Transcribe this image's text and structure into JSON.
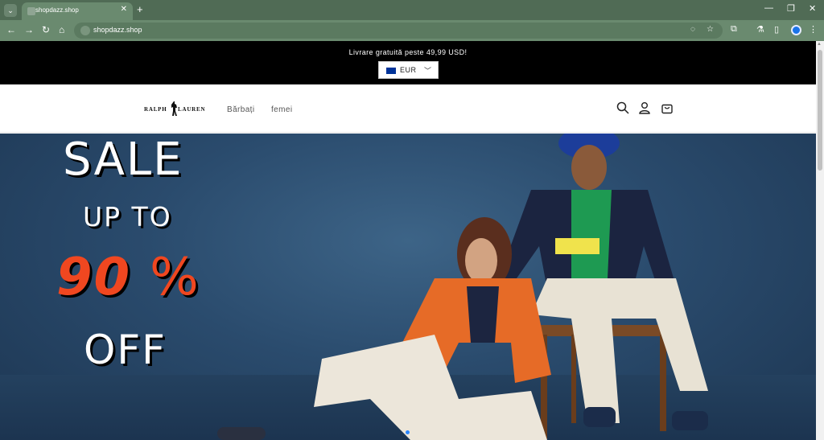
{
  "browser": {
    "tab": {
      "title": "shopdazz.shop"
    },
    "url": "shopdazz.shop",
    "icons": [
      "tab-menu",
      "new-tab",
      "minimize",
      "maximize",
      "close",
      "back",
      "forward",
      "reload",
      "home",
      "site-info",
      "eye-off",
      "star",
      "extensions",
      "labs",
      "side-panel",
      "profile",
      "more"
    ]
  },
  "store": {
    "announcement": "Livrare gratuită peste 49,99 USD!",
    "currency": {
      "code": "EUR"
    },
    "logo": {
      "left": "RALPH",
      "right": "LAUREN"
    },
    "nav": [
      {
        "label": "Bărbați"
      },
      {
        "label": "femei"
      }
    ],
    "header_icons": [
      "search-icon",
      "account-icon",
      "cart-icon"
    ]
  },
  "hero": {
    "line1": "SALE",
    "line2": "UP TO",
    "line3_number": "90",
    "line3_symbol": "%",
    "line4": "OFF",
    "accent_color": "#f04720",
    "background_color": "#2a4b6d"
  }
}
